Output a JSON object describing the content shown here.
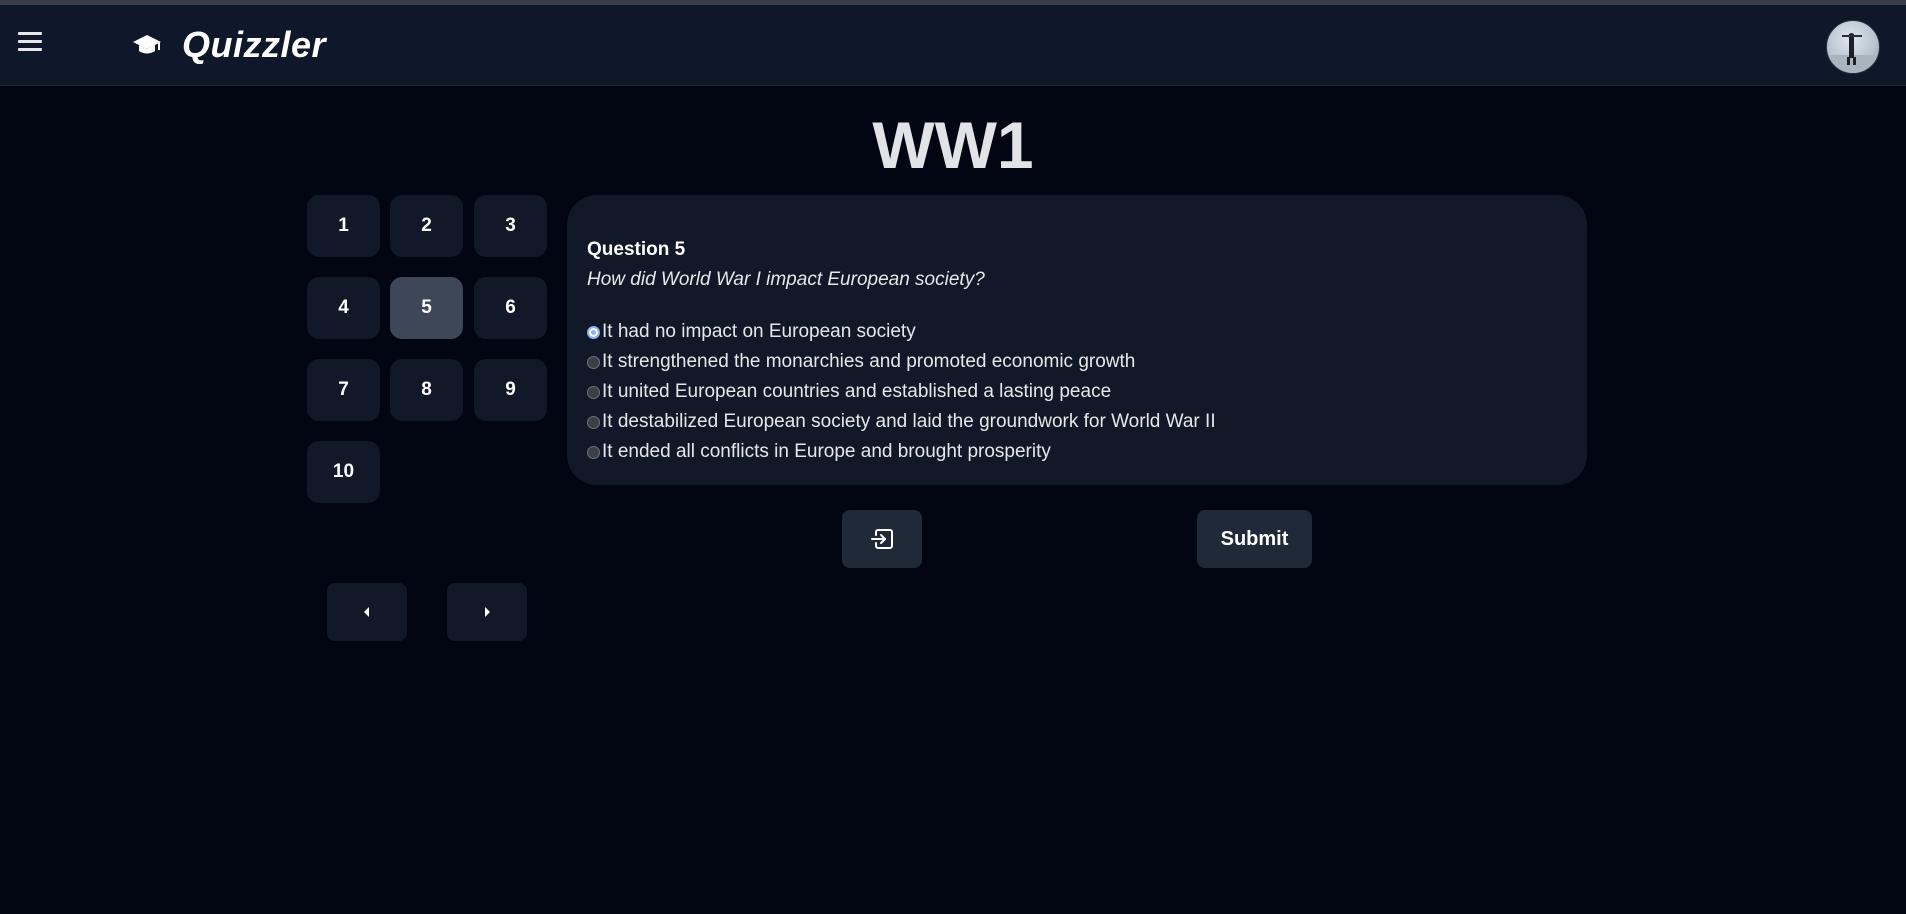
{
  "app": {
    "name": "Quizzler",
    "brand_icon": "graduation-cap-icon",
    "menu_icon": "hamburger-menu-icon"
  },
  "quiz": {
    "title": "WW1"
  },
  "navigator": {
    "questions": [
      "1",
      "2",
      "3",
      "4",
      "5",
      "6",
      "7",
      "8",
      "9",
      "10"
    ],
    "active_question": "5",
    "prev_icon": "caret-left-icon",
    "next_icon": "caret-right-icon"
  },
  "question": {
    "label": "Question 5",
    "text": "How did World War I impact European society?",
    "options": [
      "It had no impact on European society",
      "It strengthened the monarchies and promoted economic growth",
      "It united European countries and established a lasting peace",
      "It destabilized European society and laid the groundwork for World War II",
      "It ended all conflicts in Europe and brought prosperity"
    ],
    "selected_option_index": 0
  },
  "actions": {
    "exit_icon": "exit-icon",
    "submit_label": "Submit"
  },
  "colors": {
    "page_bg": "#020612",
    "header_bg": "#0f172a",
    "card_bg": "#111827",
    "active_button": "#3e4757",
    "action_button": "#1f2937"
  }
}
